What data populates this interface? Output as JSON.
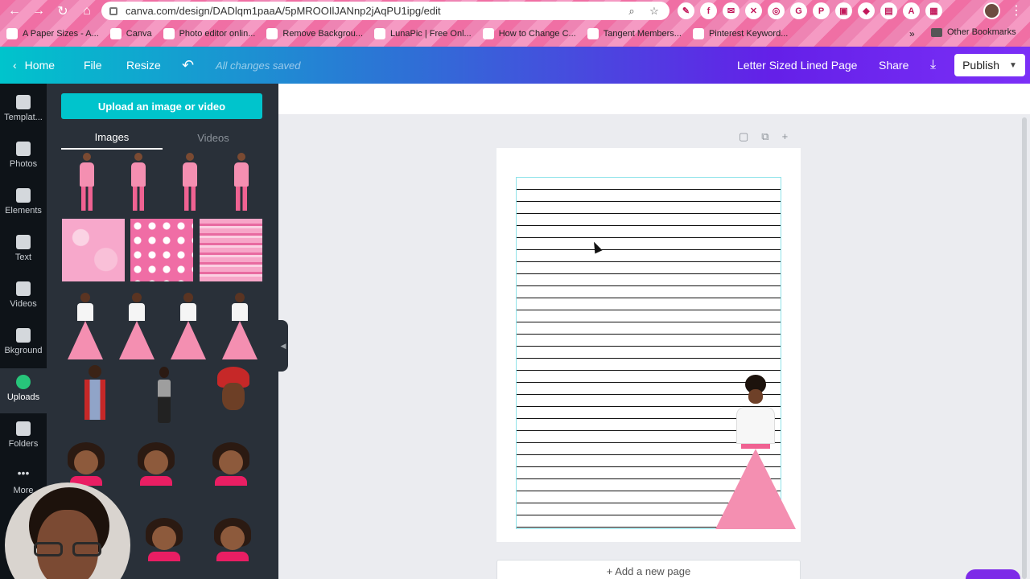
{
  "browser": {
    "url": "canva.com/design/DADlqm1paaA/5pMROOIlJANnp2jAqPU1ipg/edit",
    "bookmarks": [
      {
        "label": "A Paper Sizes - A..."
      },
      {
        "label": "Canva"
      },
      {
        "label": "Photo editor onlin..."
      },
      {
        "label": "Remove Backgrou..."
      },
      {
        "label": "LunaPic | Free Onl..."
      },
      {
        "label": "How to Change C..."
      },
      {
        "label": "Tangent Members..."
      },
      {
        "label": "Pinterest Keyword..."
      }
    ],
    "more_bookmarks": "»",
    "other_bookmarks": "Other Bookmarks"
  },
  "header": {
    "home": "Home",
    "file": "File",
    "resize": "Resize",
    "saved_status": "All changes saved",
    "design_title": "Letter Sized Lined Page",
    "share": "Share",
    "publish": "Publish"
  },
  "rail": {
    "items": [
      {
        "label": "Templat..."
      },
      {
        "label": "Photos"
      },
      {
        "label": "Elements"
      },
      {
        "label": "Text"
      },
      {
        "label": "Videos"
      },
      {
        "label": "Bkground"
      },
      {
        "label": "Uploads"
      },
      {
        "label": "Folders"
      },
      {
        "label": "More"
      }
    ],
    "active": "Uploads"
  },
  "panel": {
    "upload_button": "Upload an image or video",
    "tabs": [
      {
        "label": "Images"
      },
      {
        "label": "Videos"
      }
    ],
    "active_tab": "Images"
  },
  "canvas": {
    "add_page": "+ Add a new page"
  },
  "colors": {
    "accent": "#00c4cc",
    "header_end": "#7b2ff7",
    "active_rail_icon": "#27c57a",
    "browser_theme": "#f06fa4"
  }
}
